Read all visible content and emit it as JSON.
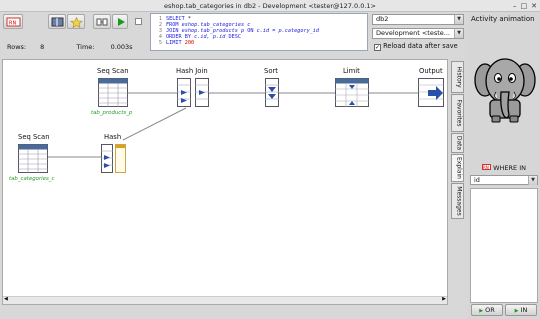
{
  "window": {
    "title": "eshop.tab_categories in db2 - Development <tester@127.0.0.1>",
    "controls": [
      "–",
      "□",
      "✕"
    ]
  },
  "toolbar": {
    "buttons": [
      "stop",
      "table-view",
      "star",
      "explain",
      "run",
      "toggle"
    ]
  },
  "sql": {
    "lines": [
      {
        "n": "1",
        "parts": [
          {
            "t": "SELECT ",
            "c": "kw"
          },
          {
            "t": "*",
            "c": ""
          }
        ]
      },
      {
        "n": "2",
        "parts": [
          {
            "t": "FROM ",
            "c": "kw"
          },
          {
            "t": "eshop.tab_categories c",
            "c": "it"
          }
        ]
      },
      {
        "n": "3",
        "parts": [
          {
            "t": "JOIN ",
            "c": "kw"
          },
          {
            "t": "eshop.tab_products p ",
            "c": "it"
          },
          {
            "t": "ON ",
            "c": "kw"
          },
          {
            "t": "c.id = p.category_id",
            "c": "it"
          }
        ]
      },
      {
        "n": "4",
        "parts": [
          {
            "t": "ORDER BY ",
            "c": "kw"
          },
          {
            "t": "c.id, p.id ",
            "c": "it"
          },
          {
            "t": "DESC",
            "c": "kw"
          }
        ]
      },
      {
        "n": "5",
        "parts": [
          {
            "t": "LIMIT ",
            "c": "kw"
          },
          {
            "t": "200",
            "c": "nm"
          }
        ]
      }
    ]
  },
  "db_select": "db2",
  "env_select": "Development <teste...",
  "reload_label": "Reload data after save",
  "reload_checked": true,
  "stats": {
    "rows_label": "Rows:",
    "rows_value": "8",
    "time_label": "Time:",
    "time_value": "0.003s"
  },
  "plan": {
    "nodes": [
      {
        "id": "seqscan1",
        "title": "Seq Scan",
        "label": "tab_products_p",
        "kind": "table"
      },
      {
        "id": "hashjoin",
        "title": "Hash Join",
        "label": "",
        "kind": "join"
      },
      {
        "id": "sort",
        "title": "Sort",
        "label": "",
        "kind": "sort"
      },
      {
        "id": "limit",
        "title": "Limit",
        "label": "",
        "kind": "limit"
      },
      {
        "id": "output",
        "title": "Output",
        "label": "",
        "kind": "output"
      },
      {
        "id": "seqscan2",
        "title": "Seq Scan",
        "label": "tab_categories_c",
        "kind": "table"
      },
      {
        "id": "hash",
        "title": "Hash",
        "label": "",
        "kind": "hash"
      }
    ]
  },
  "side_tabs": [
    "History",
    "Favorites",
    "Data",
    "Explain",
    "Messages"
  ],
  "right_panel": {
    "title": "Activity animation",
    "where_in_label": "WHERE IN",
    "id_select": "id",
    "or_button": "OR",
    "in_button": "IN"
  }
}
